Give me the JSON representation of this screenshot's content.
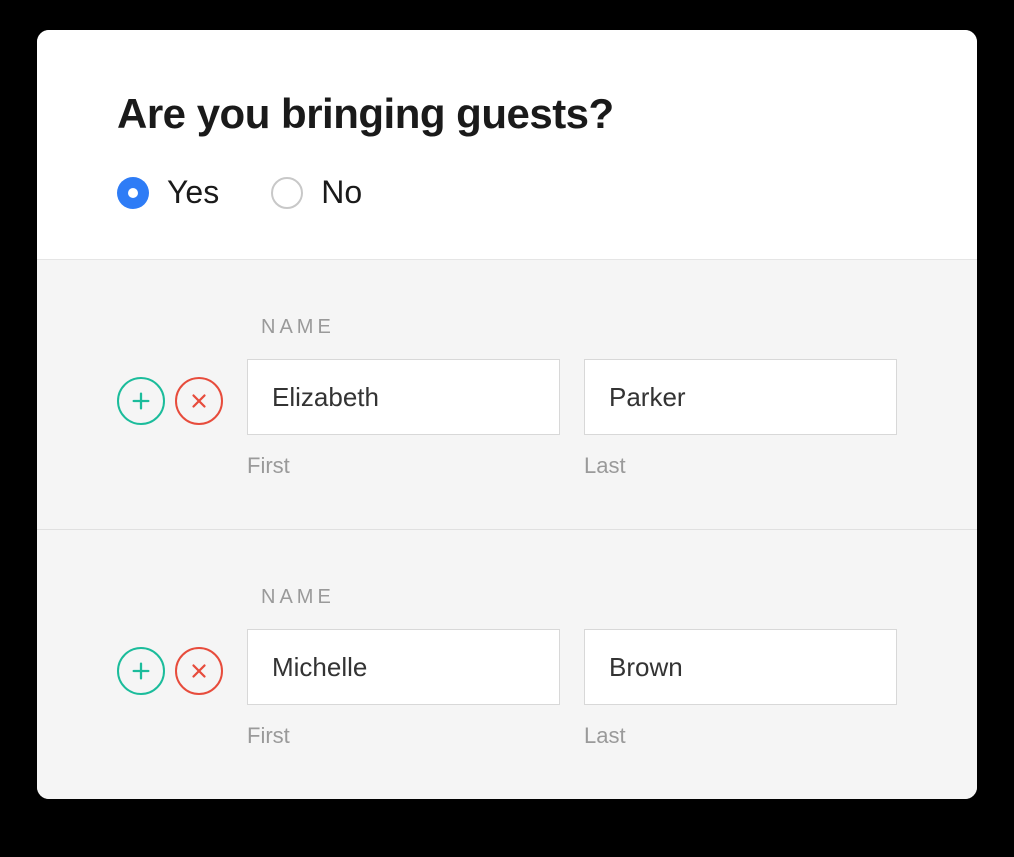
{
  "question": "Are you bringing guests?",
  "radios": {
    "yes": "Yes",
    "no": "No"
  },
  "section_label": "NAME",
  "sub_labels": {
    "first": "First",
    "last": "Last"
  },
  "guests": [
    {
      "first": "Elizabeth",
      "last": "Parker"
    },
    {
      "first": "Michelle",
      "last": "Brown"
    }
  ]
}
